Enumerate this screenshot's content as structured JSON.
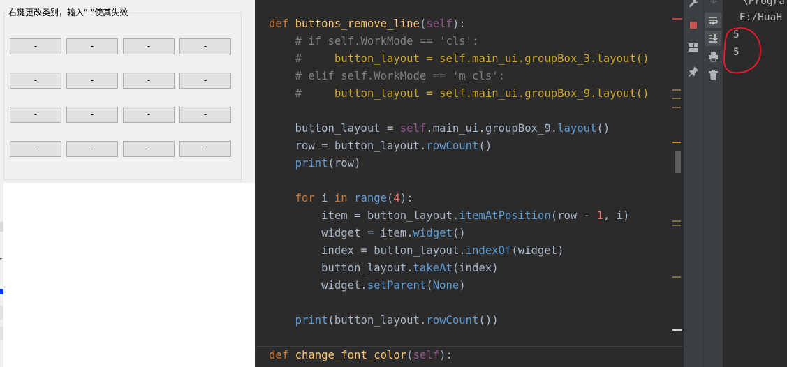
{
  "qt_window": {
    "group_title": "右键更改类别，输入\"-\"使其失效",
    "buttons": [
      [
        "-",
        "-",
        "-",
        "-"
      ],
      [
        "-",
        "-",
        "-",
        "-"
      ],
      [
        "-",
        "-",
        "-",
        "-"
      ],
      [
        "-",
        "-",
        "-",
        "-"
      ]
    ],
    "strip_letters": [
      "r"
    ]
  },
  "editor": {
    "lines": [
      [
        [
          "kw",
          "def "
        ],
        [
          "fn",
          "buttons_remove_line"
        ],
        [
          "p",
          "("
        ],
        [
          "self",
          "self"
        ],
        [
          "p",
          "):"
        ]
      ],
      [
        [
          "p",
          "    "
        ],
        [
          "cm",
          "# if self.WorkMode == 'cls':"
        ]
      ],
      [
        [
          "p",
          "    "
        ],
        [
          "cm",
          "#     "
        ],
        [
          "ds",
          "button_layout = self.main_ui.groupBox_3.layout()"
        ]
      ],
      [
        [
          "p",
          "    "
        ],
        [
          "cm",
          "# elif self.WorkMode == 'm_cls':"
        ]
      ],
      [
        [
          "p",
          "    "
        ],
        [
          "cm",
          "#     "
        ],
        [
          "ds",
          "button_layout = self.main_ui.groupBox_9.layout()"
        ]
      ],
      [],
      [
        [
          "p",
          "    button_layout = "
        ],
        [
          "self",
          "self"
        ],
        [
          "p",
          ".main_ui.groupBox_9."
        ],
        [
          "mth",
          "layout"
        ],
        [
          "p",
          "()"
        ]
      ],
      [
        [
          "p",
          "    row = button_layout."
        ],
        [
          "mth",
          "rowCount"
        ],
        [
          "p",
          "()"
        ]
      ],
      [
        [
          "p",
          "    "
        ],
        [
          "bi2",
          "print"
        ],
        [
          "p",
          "(row)"
        ]
      ],
      [],
      [
        [
          "p",
          "    "
        ],
        [
          "kw",
          "for "
        ],
        [
          "p",
          "i "
        ],
        [
          "kw",
          "in "
        ],
        [
          "bi2",
          "range"
        ],
        [
          "p",
          "("
        ],
        [
          "num",
          "4"
        ],
        [
          "p",
          "):"
        ]
      ],
      [
        [
          "p",
          "        item = button_layout."
        ],
        [
          "mth",
          "itemAtPosition"
        ],
        [
          "p",
          "(row - "
        ],
        [
          "num",
          "1"
        ],
        [
          "p",
          ", i)"
        ]
      ],
      [
        [
          "p",
          "        widget = item."
        ],
        [
          "mth",
          "widget"
        ],
        [
          "p",
          "()"
        ]
      ],
      [
        [
          "p",
          "        index = button_layout."
        ],
        [
          "mth",
          "indexOf"
        ],
        [
          "p",
          "(widget)"
        ]
      ],
      [
        [
          "p",
          "        button_layout."
        ],
        [
          "mth",
          "takeAt"
        ],
        [
          "p",
          "(index)"
        ]
      ],
      [
        [
          "p",
          "        widget."
        ],
        [
          "mth",
          "setParent"
        ],
        [
          "p",
          "("
        ],
        [
          "bi2",
          "None"
        ],
        [
          "p",
          ")"
        ]
      ],
      [],
      [
        [
          "p",
          "    "
        ],
        [
          "bi2",
          "print"
        ],
        [
          "p",
          "(button_layout."
        ],
        [
          "mth",
          "rowCount"
        ],
        [
          "p",
          "())"
        ]
      ],
      [],
      [
        [
          "kw",
          "def "
        ],
        [
          "fn",
          "change_font_color"
        ],
        [
          "p",
          "("
        ],
        [
          "self",
          "self"
        ],
        [
          "p",
          "):"
        ]
      ]
    ]
  },
  "console": {
    "lines": [
      "\\Progra",
      "E:/HuaH",
      "5",
      "5"
    ]
  },
  "colors": {
    "keyword": "#cc7832",
    "function": "#ffc66d",
    "comment": "#808080",
    "annotation_circle": "#e8192c",
    "stop_button": "#c75450"
  },
  "icons": {
    "tool1": [
      "wrench-icon",
      "stop-icon",
      "layout-icon",
      "pin-icon"
    ],
    "tool2": [
      "arrow-down-icon",
      "soft-wrap-icon",
      "scroll-to-end-icon",
      "print-icon",
      "trash-icon"
    ]
  }
}
